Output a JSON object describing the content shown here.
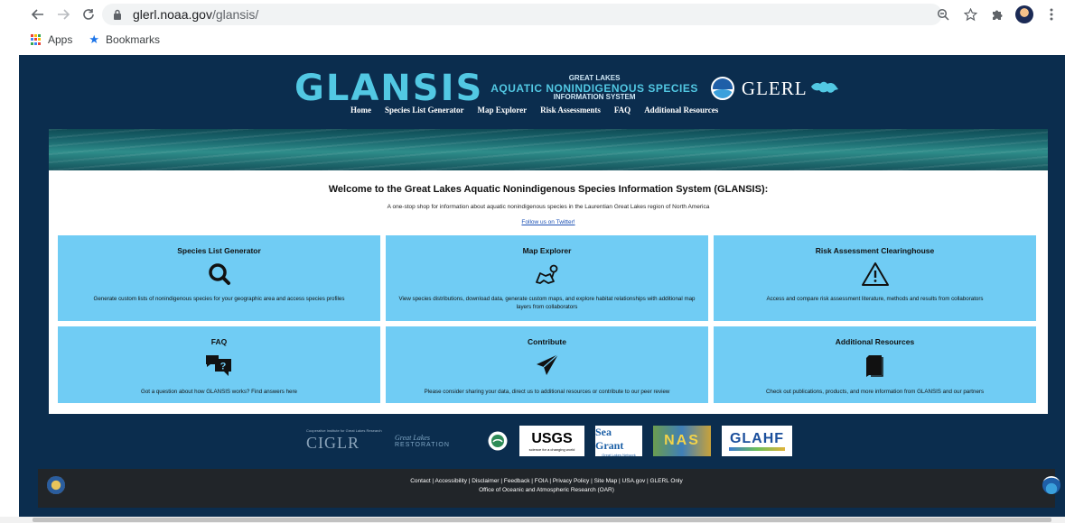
{
  "browser": {
    "url_domain": "glerl.noaa.gov",
    "url_path": "/glansis/",
    "bookmarks": [
      {
        "label": "Apps"
      },
      {
        "label": "Bookmarks"
      }
    ]
  },
  "header": {
    "logo_text": "GLANSIS",
    "logo_sub1": "GREAT LAKES",
    "logo_sub2": "AQUATIC NONINDIGENOUS SPECIES",
    "logo_sub3": "INFORMATION SYSTEM",
    "glerl_text": "GLERL",
    "nav": [
      "Home",
      "Species List Generator",
      "Map Explorer",
      "Risk Assessments",
      "FAQ",
      "Additional Resources"
    ]
  },
  "welcome": {
    "title": "Welcome to the Great Lakes Aquatic Nonindigenous Species Information System (GLANSIS):",
    "subtitle": "A one-stop shop for information about aquatic nonindigenous species in the Laurentian Great Lakes region of North America",
    "follow": "Follow us on Twitter!"
  },
  "cards": [
    {
      "title": "Species List Generator",
      "desc": "Generate custom lists of nonindigenous species for your geographic area and access species profiles",
      "icon": "search-icon"
    },
    {
      "title": "Map Explorer",
      "desc": "View species distributions, download data, generate custom maps, and explore habitat relationships with additional map layers from collaborators",
      "icon": "map-icon"
    },
    {
      "title": "Risk Assessment Clearinghouse",
      "desc": "Access and compare risk assessment literature, methods and results from collaborators",
      "icon": "warning-icon"
    },
    {
      "title": "FAQ",
      "desc": "Got a question about how GLANSIS works? Find answers here",
      "icon": "faq-icon"
    },
    {
      "title": "Contribute",
      "desc": "Please consider sharing your data, direct us to additional resources or contribute to our peer review",
      "icon": "send-icon"
    },
    {
      "title": "Additional Resources",
      "desc": "Check out publications, products, and more information from GLANSIS and our partners",
      "icon": "book-icon"
    }
  ],
  "partners": {
    "ciglr": "CIGLR",
    "ciglr_top": "Cooperative Institute for Great Lakes Research",
    "restoration_top": "Great Lakes",
    "restoration": "RESTORATION",
    "usgs": "USGS",
    "usgs_tag": "science for a changing world",
    "seagrant": "Sea Grant",
    "seagrant_sub": "Great Lakes Network",
    "nas": "NAS",
    "glahf": "GLAHF"
  },
  "footer": {
    "links": "Contact | Accessibility | Disclaimer | Feedback | FOIA | Privacy Policy | Site Map | USA.gov | GLERL Only",
    "oar": "Office of Oceanic and Atmospheric Research (OAR)"
  },
  "colors": {
    "page_bg": "#0b2d4e",
    "card_bg": "#70ccf4",
    "logo_accent": "#52c8e3",
    "footer_bg": "#212529"
  }
}
